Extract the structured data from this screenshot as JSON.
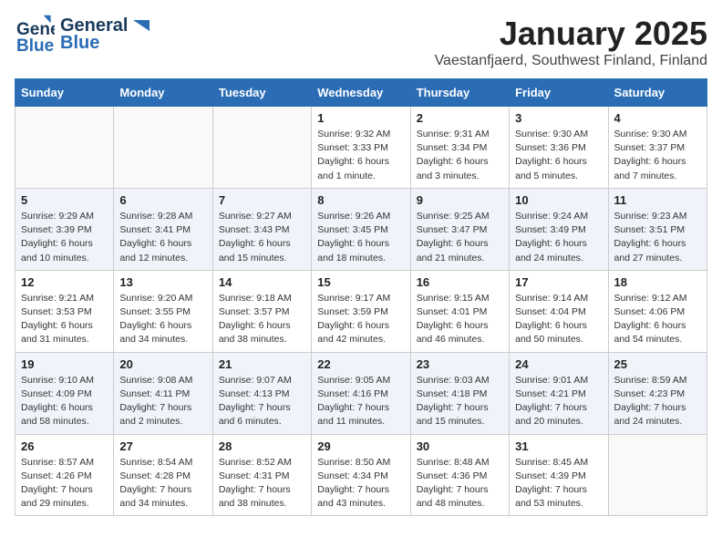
{
  "header": {
    "logo_line1": "General",
    "logo_line2": "Blue",
    "month": "January 2025",
    "location": "Vaestanfjaerd, Southwest Finland, Finland"
  },
  "days_of_week": [
    "Sunday",
    "Monday",
    "Tuesday",
    "Wednesday",
    "Thursday",
    "Friday",
    "Saturday"
  ],
  "weeks": [
    [
      {
        "day": "",
        "info": ""
      },
      {
        "day": "",
        "info": ""
      },
      {
        "day": "",
        "info": ""
      },
      {
        "day": "1",
        "info": "Sunrise: 9:32 AM\nSunset: 3:33 PM\nDaylight: 6 hours and 1 minute."
      },
      {
        "day": "2",
        "info": "Sunrise: 9:31 AM\nSunset: 3:34 PM\nDaylight: 6 hours and 3 minutes."
      },
      {
        "day": "3",
        "info": "Sunrise: 9:30 AM\nSunset: 3:36 PM\nDaylight: 6 hours and 5 minutes."
      },
      {
        "day": "4",
        "info": "Sunrise: 9:30 AM\nSunset: 3:37 PM\nDaylight: 6 hours and 7 minutes."
      }
    ],
    [
      {
        "day": "5",
        "info": "Sunrise: 9:29 AM\nSunset: 3:39 PM\nDaylight: 6 hours and 10 minutes."
      },
      {
        "day": "6",
        "info": "Sunrise: 9:28 AM\nSunset: 3:41 PM\nDaylight: 6 hours and 12 minutes."
      },
      {
        "day": "7",
        "info": "Sunrise: 9:27 AM\nSunset: 3:43 PM\nDaylight: 6 hours and 15 minutes."
      },
      {
        "day": "8",
        "info": "Sunrise: 9:26 AM\nSunset: 3:45 PM\nDaylight: 6 hours and 18 minutes."
      },
      {
        "day": "9",
        "info": "Sunrise: 9:25 AM\nSunset: 3:47 PM\nDaylight: 6 hours and 21 minutes."
      },
      {
        "day": "10",
        "info": "Sunrise: 9:24 AM\nSunset: 3:49 PM\nDaylight: 6 hours and 24 minutes."
      },
      {
        "day": "11",
        "info": "Sunrise: 9:23 AM\nSunset: 3:51 PM\nDaylight: 6 hours and 27 minutes."
      }
    ],
    [
      {
        "day": "12",
        "info": "Sunrise: 9:21 AM\nSunset: 3:53 PM\nDaylight: 6 hours and 31 minutes."
      },
      {
        "day": "13",
        "info": "Sunrise: 9:20 AM\nSunset: 3:55 PM\nDaylight: 6 hours and 34 minutes."
      },
      {
        "day": "14",
        "info": "Sunrise: 9:18 AM\nSunset: 3:57 PM\nDaylight: 6 hours and 38 minutes."
      },
      {
        "day": "15",
        "info": "Sunrise: 9:17 AM\nSunset: 3:59 PM\nDaylight: 6 hours and 42 minutes."
      },
      {
        "day": "16",
        "info": "Sunrise: 9:15 AM\nSunset: 4:01 PM\nDaylight: 6 hours and 46 minutes."
      },
      {
        "day": "17",
        "info": "Sunrise: 9:14 AM\nSunset: 4:04 PM\nDaylight: 6 hours and 50 minutes."
      },
      {
        "day": "18",
        "info": "Sunrise: 9:12 AM\nSunset: 4:06 PM\nDaylight: 6 hours and 54 minutes."
      }
    ],
    [
      {
        "day": "19",
        "info": "Sunrise: 9:10 AM\nSunset: 4:09 PM\nDaylight: 6 hours and 58 minutes."
      },
      {
        "day": "20",
        "info": "Sunrise: 9:08 AM\nSunset: 4:11 PM\nDaylight: 7 hours and 2 minutes."
      },
      {
        "day": "21",
        "info": "Sunrise: 9:07 AM\nSunset: 4:13 PM\nDaylight: 7 hours and 6 minutes."
      },
      {
        "day": "22",
        "info": "Sunrise: 9:05 AM\nSunset: 4:16 PM\nDaylight: 7 hours and 11 minutes."
      },
      {
        "day": "23",
        "info": "Sunrise: 9:03 AM\nSunset: 4:18 PM\nDaylight: 7 hours and 15 minutes."
      },
      {
        "day": "24",
        "info": "Sunrise: 9:01 AM\nSunset: 4:21 PM\nDaylight: 7 hours and 20 minutes."
      },
      {
        "day": "25",
        "info": "Sunrise: 8:59 AM\nSunset: 4:23 PM\nDaylight: 7 hours and 24 minutes."
      }
    ],
    [
      {
        "day": "26",
        "info": "Sunrise: 8:57 AM\nSunset: 4:26 PM\nDaylight: 7 hours and 29 minutes."
      },
      {
        "day": "27",
        "info": "Sunrise: 8:54 AM\nSunset: 4:28 PM\nDaylight: 7 hours and 34 minutes."
      },
      {
        "day": "28",
        "info": "Sunrise: 8:52 AM\nSunset: 4:31 PM\nDaylight: 7 hours and 38 minutes."
      },
      {
        "day": "29",
        "info": "Sunrise: 8:50 AM\nSunset: 4:34 PM\nDaylight: 7 hours and 43 minutes."
      },
      {
        "day": "30",
        "info": "Sunrise: 8:48 AM\nSunset: 4:36 PM\nDaylight: 7 hours and 48 minutes."
      },
      {
        "day": "31",
        "info": "Sunrise: 8:45 AM\nSunset: 4:39 PM\nDaylight: 7 hours and 53 minutes."
      },
      {
        "day": "",
        "info": ""
      }
    ]
  ]
}
